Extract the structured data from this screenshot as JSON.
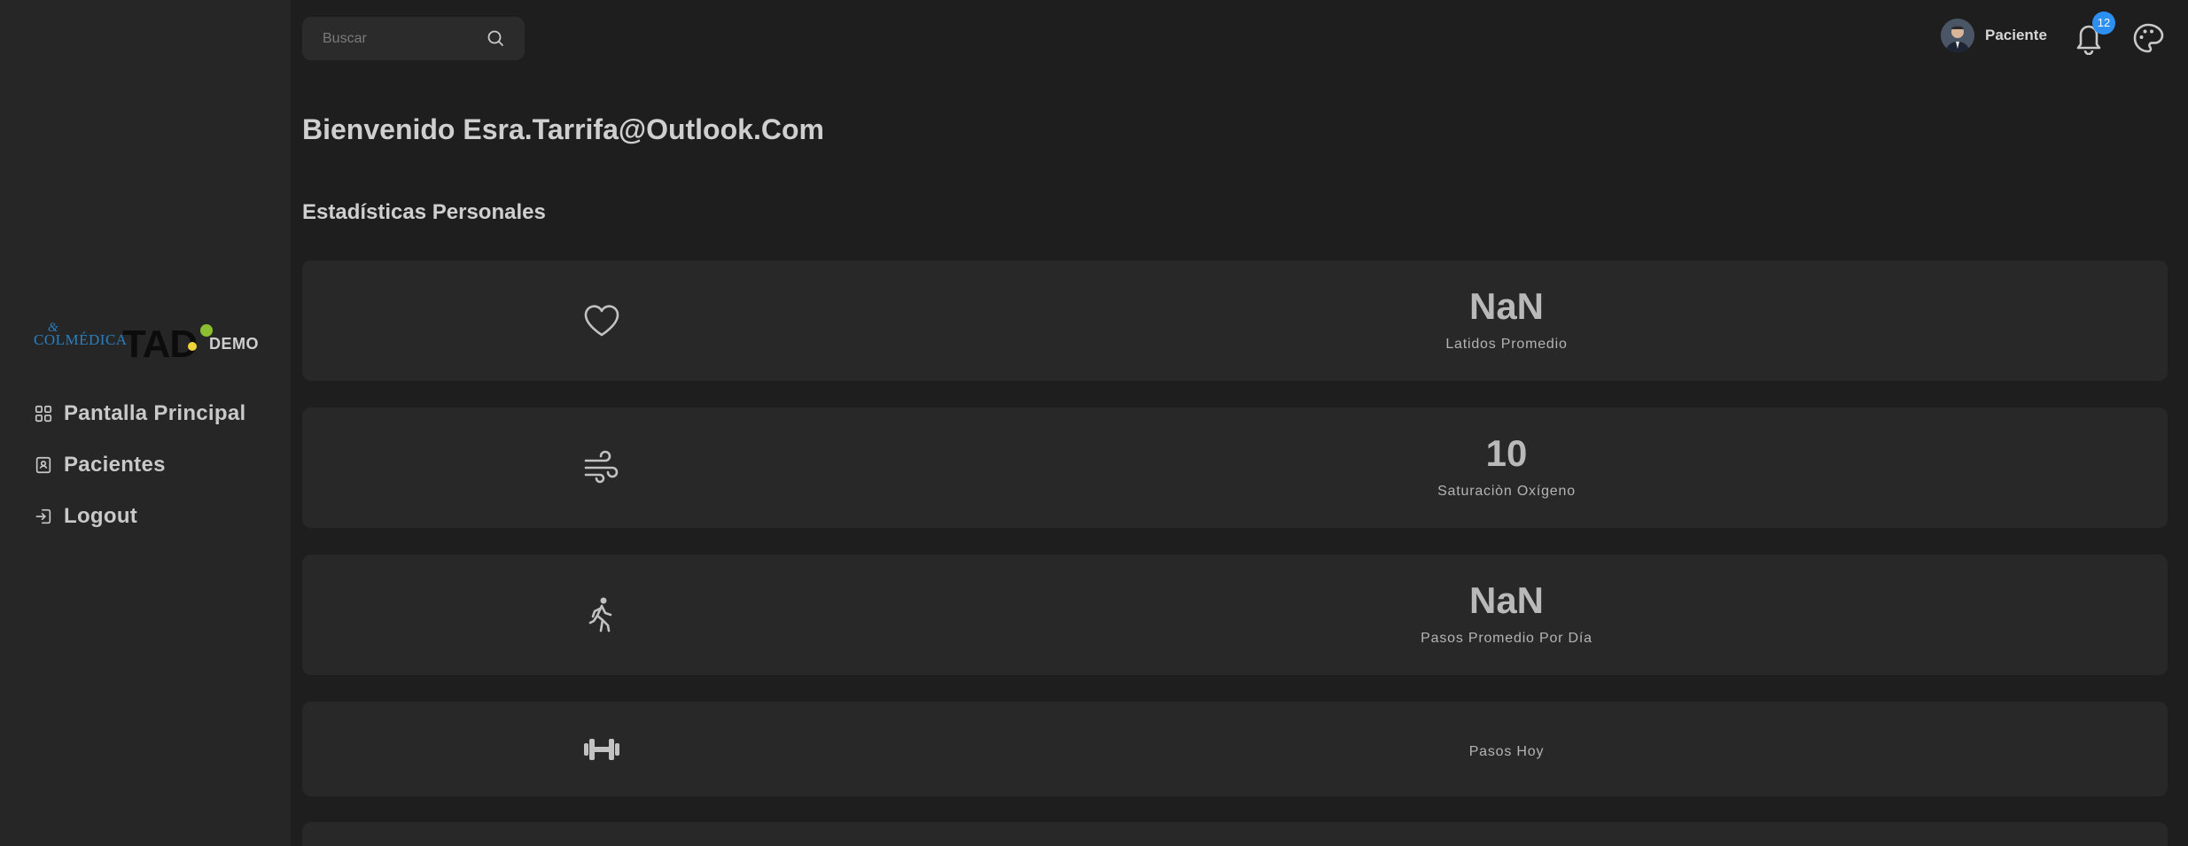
{
  "sidebar": {
    "logo": {
      "brand_left": "COLMÉDICA",
      "brand_amp": "&",
      "brand_main": "TAD",
      "brand_tag": "DEMO"
    },
    "items": [
      {
        "label": "Pantalla Principal",
        "icon": "grid-icon"
      },
      {
        "label": "Pacientes",
        "icon": "contact-card-icon"
      },
      {
        "label": "Logout",
        "icon": "logout-icon"
      }
    ]
  },
  "header": {
    "search_placeholder": "Buscar",
    "search_value": "",
    "user_role": "Paciente",
    "notification_count": "12",
    "colors": {
      "badge": "#2d8ff0",
      "background": "#1e1e1e",
      "sidebar": "#262626",
      "card": "#282828"
    }
  },
  "main": {
    "welcome": "Bienvenido Esra.Tarrifa@Outlook.Com",
    "section_title": "Estadísticas Personales",
    "stats": [
      {
        "icon": "heart-icon",
        "value": "NaN",
        "label": "Latidos Promedio"
      },
      {
        "icon": "wind-icon",
        "value": "10",
        "label": "Saturaciòn Oxígeno"
      },
      {
        "icon": "walking-icon",
        "value": "NaN",
        "label": "Pasos Promedio Por Día"
      },
      {
        "icon": "dumbbell-icon",
        "value": "",
        "label": "Pasos Hoy"
      }
    ]
  }
}
